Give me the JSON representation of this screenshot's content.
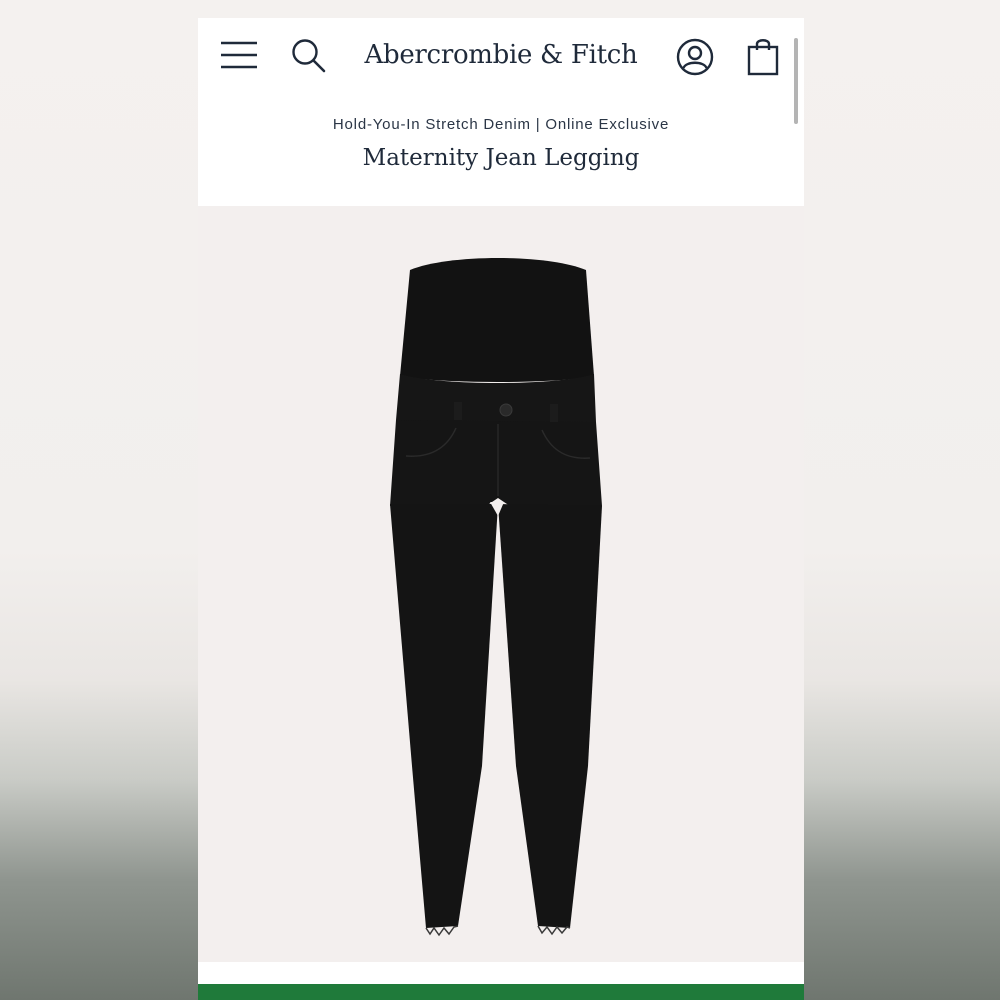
{
  "header": {
    "brand": "Abercrombie & Fitch",
    "icons": [
      "menu-icon",
      "search-icon",
      "account-icon",
      "shopping-bag-icon"
    ]
  },
  "product": {
    "subtitle": "Hold-You-In Stretch Denim | Online Exclusive",
    "title": "Maternity Jean Legging",
    "image_subject": "black maternity jean legging with full belly panel, raw hem"
  },
  "colors": {
    "brand_navy": "#1f2a3a",
    "accent_green": "#1f7a3a",
    "denim_black": "#141414"
  }
}
